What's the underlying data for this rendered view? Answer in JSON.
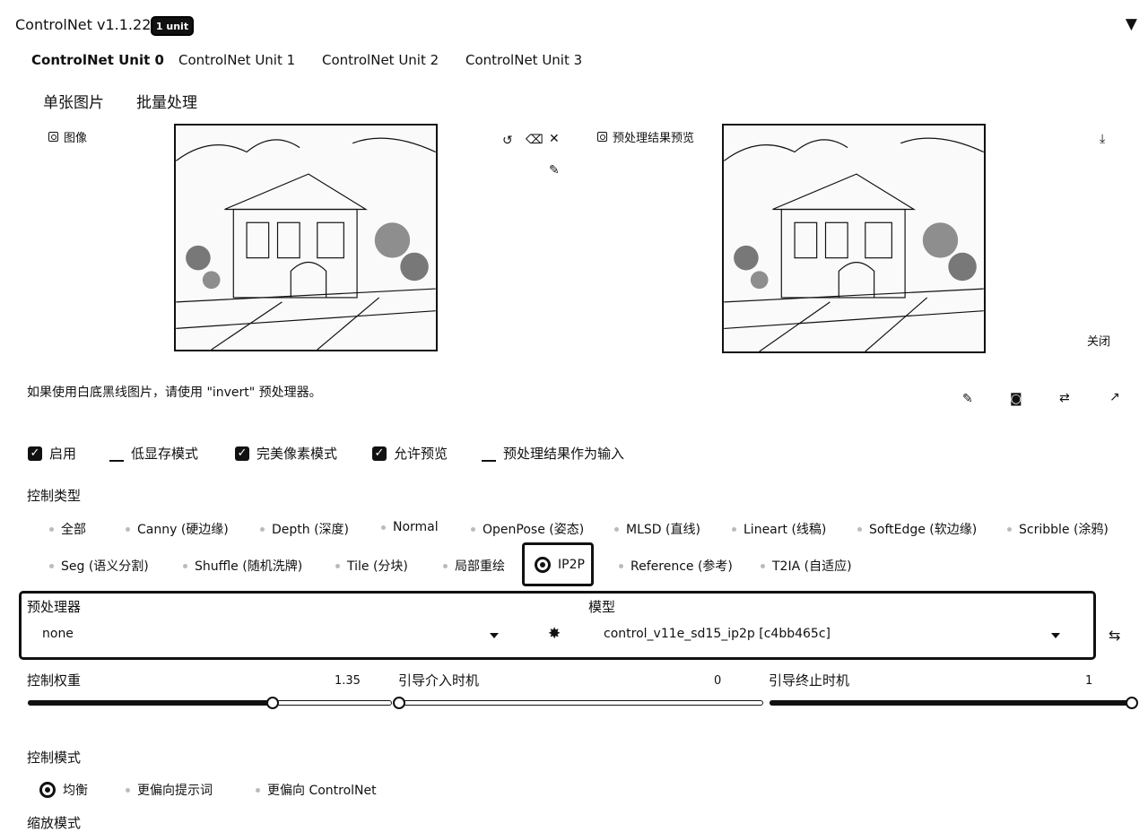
{
  "header": {
    "title": "ControlNet v1.1.224",
    "badge": "1 unit",
    "collapse_icon": "▼"
  },
  "tabs": [
    {
      "label": "ControlNet Unit 0"
    },
    {
      "label": "ControlNet Unit 1"
    },
    {
      "label": "ControlNet Unit 2"
    },
    {
      "label": "ControlNet Unit 3"
    }
  ],
  "subtabs": [
    {
      "label": "单张图片"
    },
    {
      "label": "批量处理"
    }
  ],
  "image_panel": {
    "label": "图像"
  },
  "preview_panel": {
    "label": "预处理结果预览",
    "close_label": "关闭"
  },
  "hint": "如果使用白底黑线图片，请使用 \"invert\" 预处理器。",
  "checkboxes": [
    {
      "label": "启用",
      "checked": true
    },
    {
      "label": "低显存模式",
      "checked": false
    },
    {
      "label": "完美像素模式",
      "checked": true
    },
    {
      "label": "允许预览",
      "checked": true
    },
    {
      "label": "预处理结果作为输入",
      "checked": false
    }
  ],
  "control_type": {
    "label": "控制类型",
    "options_row1": [
      "全部",
      "Canny (硬边缘)",
      "Depth (深度)",
      "Normal",
      "OpenPose (姿态)",
      "MLSD (直线)",
      "Lineart (线稿)",
      "SoftEdge (软边缘)",
      "Scribble (涂鸦)"
    ],
    "options_row2": [
      "Seg (语义分割)",
      "Shuffle (随机洗牌)",
      "Tile (分块)",
      "局部重绘",
      "IP2P",
      "Reference (参考)",
      "T2IA (自适应)"
    ],
    "selected": "IP2P"
  },
  "preprocessor": {
    "label": "预处理器",
    "value": "none"
  },
  "model": {
    "label": "模型",
    "value": "control_v11e_sd15_ip2p [c4bb465c]"
  },
  "sliders": {
    "weight": {
      "label": "控制权重",
      "value": "1.35",
      "fraction": 0.675
    },
    "start": {
      "label": "引导介入时机",
      "value": "0",
      "fraction": 0.0
    },
    "end": {
      "label": "引导终止时机",
      "value": "1",
      "fraction": 1.0
    }
  },
  "control_mode": {
    "label": "控制模式",
    "options": [
      "均衡",
      "更偏向提示词",
      "更偏向 ControlNet"
    ],
    "selected": "均衡"
  },
  "resize_mode": {
    "label": "缩放模式"
  }
}
